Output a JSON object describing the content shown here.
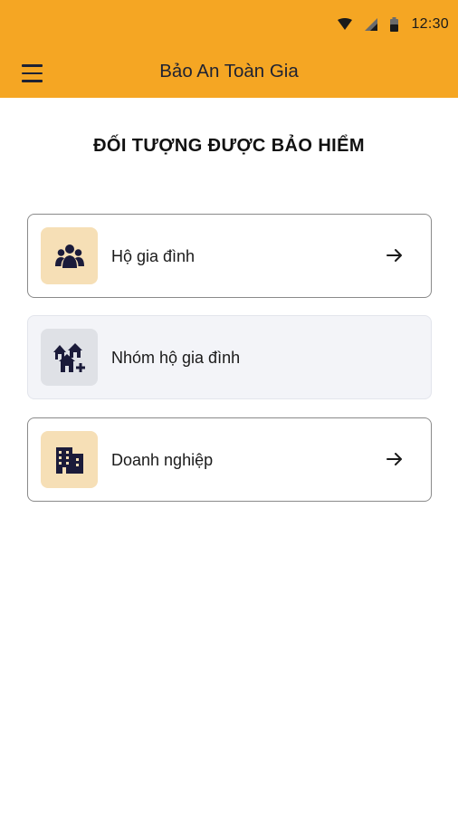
{
  "status_bar": {
    "time": "12:30",
    "icons": [
      "wifi-icon",
      "signal-icon",
      "battery-icon"
    ]
  },
  "toolbar": {
    "title": "Bảo An Toàn Gia",
    "menu_icon": "hamburger-menu-icon"
  },
  "page": {
    "heading": "ĐỐI TƯỢNG ĐƯỢC BẢO HIỂM"
  },
  "options": [
    {
      "label": "Hộ gia đình",
      "icon": "family-group-icon",
      "enabled": true,
      "show_arrow": true
    },
    {
      "label": "Nhóm hộ gia đình",
      "icon": "houses-add-icon",
      "enabled": false,
      "show_arrow": false
    },
    {
      "label": "Doanh nghiệp",
      "icon": "building-icon",
      "enabled": true,
      "show_arrow": true
    }
  ],
  "colors": {
    "brand": "#F5A623",
    "icon_bg_active": "#F6DFB6",
    "icon_bg_disabled": "#DFE1E6",
    "card_disabled_bg": "#F3F4F8",
    "icon_fg": "#1B1B3A"
  }
}
